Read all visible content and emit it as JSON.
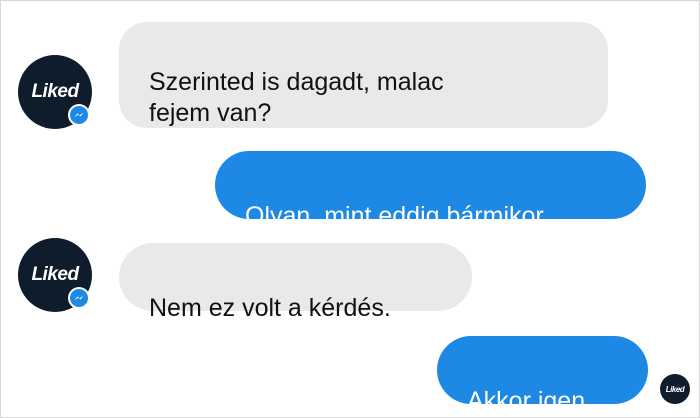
{
  "avatar": {
    "text": "Liked"
  },
  "messages": [
    {
      "direction": "incoming",
      "text": "Szerinted is dagadt, malac\nfejem van?"
    },
    {
      "direction": "outgoing",
      "text": "Olyan, mint eddig bármikor."
    },
    {
      "direction": "incoming",
      "text": "Nem ez volt a kérdés."
    },
    {
      "direction": "outgoing",
      "text": "Akkor igen."
    }
  ],
  "colors": {
    "incoming_bubble": "#e9e9eb",
    "outgoing_bubble": "#1e88e5",
    "avatar_bg": "#0f1c2b",
    "messenger_badge": "#1e88e5"
  },
  "icons": {
    "avatar_badge": "messenger-icon",
    "read_receipt": "read-receipt-avatar"
  }
}
